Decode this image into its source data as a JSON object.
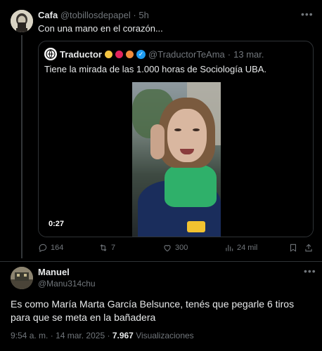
{
  "colors": {
    "background": "#000000",
    "text": "#e7e9ea",
    "muted": "#71767b",
    "border": "#2f3336",
    "verified": "#1d9bf0"
  },
  "tweet1": {
    "author_name": "Cafa",
    "author_handle": "@tobillosdepapel",
    "separator": "·",
    "time": "5h",
    "text": "Con una mano en el corazón...",
    "avatar_icon": "avatar-image",
    "more_icon": "more-options-icon",
    "actions": {
      "reply": {
        "icon": "reply-icon",
        "count": "164"
      },
      "retweet": {
        "icon": "retweet-icon",
        "count": "7"
      },
      "like": {
        "icon": "heart-icon",
        "count": "300"
      },
      "views": {
        "icon": "views-chart-icon",
        "count": "24 mil"
      },
      "bookmark": {
        "icon": "bookmark-icon"
      },
      "share": {
        "icon": "share-icon"
      }
    }
  },
  "quoted_tweet": {
    "author_name": "Traductor",
    "author_handle": "@TraductorTeAma",
    "separator": "·",
    "date": "13 mar.",
    "text": "Tiene la mirada de las 1.000 horas de Sociología UBA.",
    "verified_icon": "verified-badge-icon",
    "video_duration": "0:27"
  },
  "tweet2": {
    "author_name": "Manuel",
    "author_handle": "@Manu314chu",
    "text": "Es como María Marta García Belsunce, tenés que pegarle 6 tiros para que se meta en la bañadera",
    "time": "9:54 a. m.",
    "date": "14 mar. 2025",
    "meta_separator": "·",
    "views_count": "7.967",
    "views_label": "Visualizaciones"
  }
}
